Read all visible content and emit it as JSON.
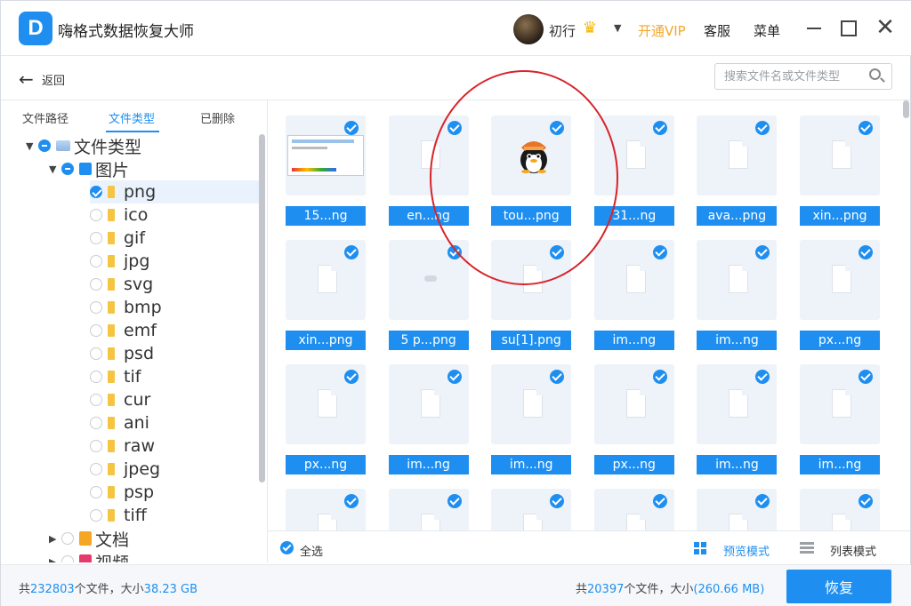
{
  "app": {
    "title": "嗨格式数据恢复大师",
    "logo_letter": "D",
    "user_name": "初行",
    "vip_label": "开通VIP",
    "service_label": "客服",
    "menu_label": "菜单"
  },
  "toolbar": {
    "back_label": "返回",
    "search_placeholder": "搜索文件名或文件类型"
  },
  "sidebar": {
    "tabs": [
      "文件路径",
      "文件类型",
      "已删除"
    ],
    "active_tab": "文件类型",
    "root": "文件类型",
    "images": "图片",
    "image_types": [
      "png",
      "ico",
      "gif",
      "jpg",
      "svg",
      "bmp",
      "emf",
      "psd",
      "tif",
      "cur",
      "ani",
      "raw",
      "jpeg",
      "psp",
      "tiff"
    ],
    "selected_type": "png",
    "documents": "文档",
    "videos": "视频"
  },
  "grid": {
    "files": [
      {
        "label": "15...ng",
        "thumb": "screenshot"
      },
      {
        "label": "en...ng",
        "thumb": "file"
      },
      {
        "label": "tou...png",
        "thumb": "penguin"
      },
      {
        "label": "31...ng",
        "thumb": "file"
      },
      {
        "label": "ava...png",
        "thumb": "file"
      },
      {
        "label": "xin...png",
        "thumb": "file"
      },
      {
        "label": "xin...png",
        "thumb": "file"
      },
      {
        "label": "5  p...png",
        "thumb": "cloud"
      },
      {
        "label": "su[1].png",
        "thumb": "file"
      },
      {
        "label": "im...ng",
        "thumb": "file"
      },
      {
        "label": "im...ng",
        "thumb": "file"
      },
      {
        "label": "px...ng",
        "thumb": "file"
      },
      {
        "label": "px...ng",
        "thumb": "file"
      },
      {
        "label": "im...ng",
        "thumb": "file"
      },
      {
        "label": "im...ng",
        "thumb": "file"
      },
      {
        "label": "px...ng",
        "thumb": "file"
      },
      {
        "label": "im...ng",
        "thumb": "file"
      },
      {
        "label": "im...ng",
        "thumb": "file"
      },
      {
        "label": "",
        "thumb": "file"
      },
      {
        "label": "",
        "thumb": "file"
      },
      {
        "label": "",
        "thumb": "file"
      },
      {
        "label": "",
        "thumb": "file"
      },
      {
        "label": "",
        "thumb": "file"
      },
      {
        "label": "",
        "thumb": "file"
      }
    ],
    "select_all_label": "全选",
    "preview_mode_label": "预览模式",
    "list_mode_label": "列表模式"
  },
  "status": {
    "total_prefix": "共",
    "total_count": "232803",
    "total_mid": "个文件，大小",
    "total_size": "38.23 GB",
    "sel_prefix": "共",
    "sel_count": "20397",
    "sel_mid": "个文件，大小",
    "sel_size": "(260.66 MB)",
    "recover_label": "恢复"
  },
  "colors": {
    "accent": "#1e8ff0",
    "vip": "#f3a72a",
    "annotation": "#d8232a"
  }
}
